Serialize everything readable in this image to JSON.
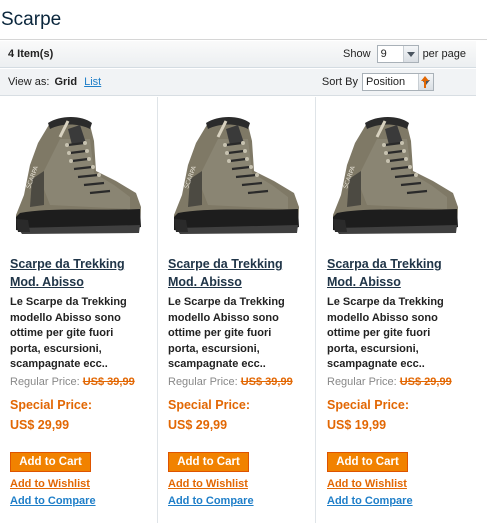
{
  "page": {
    "title": "Scarpe"
  },
  "toolbar": {
    "item_count": "4 Item(s)",
    "show_label": "Show",
    "show_value": "9",
    "per_page_label": "per page",
    "view_as_label": "View as:",
    "view_grid": "Grid",
    "view_list": "List",
    "sort_by_label": "Sort By",
    "sort_by_value": "Position"
  },
  "products": [
    {
      "name_line1": "Scarpe da Trekking",
      "name_line2": "Mod. Abisso",
      "desc_line1": "Le Scarpe da Trekking",
      "desc_line2": "modello Abisso sono",
      "desc_line3": "ottime per gite fuori",
      "desc_line4": "porta, escursioni,",
      "desc_line5": "scampagnate ecc..",
      "regular_label": "Regular Price:",
      "regular_price": "US$ 39,99",
      "special_label": "Special Price:",
      "special_price": "US$ 29,99",
      "add_to_cart": "Add to Cart",
      "add_to_wishlist": "Add to Wishlist",
      "add_to_compare": "Add to Compare"
    },
    {
      "name_line1": "Scarpe da Trekking",
      "name_line2": "Mod. Abisso",
      "desc_line1": "Le Scarpe da Trekking",
      "desc_line2": "modello Abisso sono",
      "desc_line3": "ottime per gite fuori",
      "desc_line4": "porta, escursioni,",
      "desc_line5": "scampagnate ecc..",
      "regular_label": "Regular Price:",
      "regular_price": "US$ 39,99",
      "special_label": "Special Price:",
      "special_price": "US$ 29,99",
      "add_to_cart": "Add to Cart",
      "add_to_wishlist": "Add to Wishlist",
      "add_to_compare": "Add to Compare"
    },
    {
      "name_line1": "Scarpa da Trekking",
      "name_line2": "Mod. Abisso",
      "desc_line1": "Le Scarpe da Trekking",
      "desc_line2": "modello Abisso sono",
      "desc_line3": "ottime per gite fuori",
      "desc_line4": "porta, escursioni,",
      "desc_line5": "scampagnate ecc..",
      "regular_label": "Regular Price:",
      "regular_price": "US$ 29,99",
      "special_label": "Special Price:",
      "special_price": "US$ 19,99",
      "add_to_cart": "Add to Cart",
      "add_to_wishlist": "Add to Wishlist",
      "add_to_compare": "Add to Compare"
    }
  ],
  "icons": {
    "product_image": "hiking-boot-image",
    "sort_direction": "sort-arrow-up-icon",
    "dropdown": "chevron-down-icon"
  },
  "colors": {
    "accent_orange": "#f18200",
    "price_orange": "#e26703",
    "link_blue": "#1e7ec8",
    "title_navy": "#0a263c"
  }
}
